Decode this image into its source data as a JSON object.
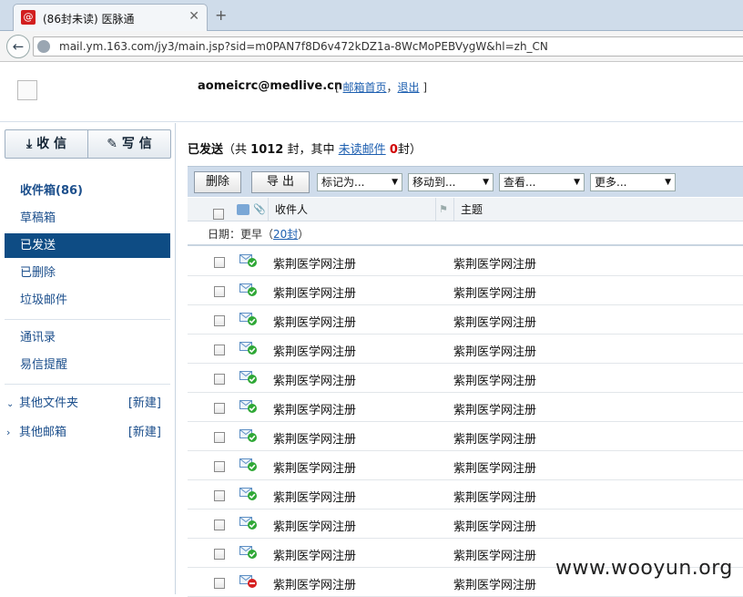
{
  "browser": {
    "tab_title": "(86封未读) 医脉通",
    "tab_favicon": "@",
    "tab_close": "✕",
    "new_tab": "+",
    "url": "mail.ym.163.com/jy3/main.jsp?sid=m0PAN7f8D6v472kDZ1a-8WcMoPEBVygW&hl=zh_CN"
  },
  "header": {
    "email": "aomeicrc@medlive.cn",
    "bracket_open": "[",
    "home_link": "邮箱首页",
    "comma": "，",
    "logout_link": "退出",
    "bracket_close": "]"
  },
  "sidebar": {
    "receive_label": "收 信",
    "compose_label": "写 信",
    "items": [
      {
        "label": "收件箱(86)"
      },
      {
        "label": "草稿箱"
      },
      {
        "label": "已发送"
      },
      {
        "label": "已删除"
      },
      {
        "label": "垃圾邮件"
      },
      {
        "label": "通讯录"
      },
      {
        "label": "易信提醒"
      }
    ],
    "other_folders": "其他文件夹",
    "other_mailboxes": "其他邮箱",
    "new_link": "[新建]"
  },
  "main": {
    "title": "已发送",
    "summary_pre": "（共",
    "total": "1012",
    "summary_mid": "封，其中",
    "unread_link": "未读邮件",
    "unread_count": "0",
    "summary_post": "封）",
    "toolbar": {
      "delete": "删除",
      "export": "导 出",
      "mark_as": "标记为...",
      "move_to": "移动到...",
      "view": "查看...",
      "more": "更多..."
    },
    "columns": {
      "recipient": "收件人",
      "subject": "主题"
    },
    "date_group": {
      "label": "日期：更早（",
      "count_link": "20封",
      "close": "）"
    },
    "rows": [
      {
        "recipient": "紫荆医学网注册",
        "subject": "紫荆医学网注册",
        "status": "ok"
      },
      {
        "recipient": "紫荆医学网注册",
        "subject": "紫荆医学网注册",
        "status": "ok"
      },
      {
        "recipient": "紫荆医学网注册",
        "subject": "紫荆医学网注册",
        "status": "ok"
      },
      {
        "recipient": "紫荆医学网注册",
        "subject": "紫荆医学网注册",
        "status": "ok"
      },
      {
        "recipient": "紫荆医学网注册",
        "subject": "紫荆医学网注册",
        "status": "ok"
      },
      {
        "recipient": "紫荆医学网注册",
        "subject": "紫荆医学网注册",
        "status": "ok"
      },
      {
        "recipient": "紫荆医学网注册",
        "subject": "紫荆医学网注册",
        "status": "ok"
      },
      {
        "recipient": "紫荆医学网注册",
        "subject": "紫荆医学网注册",
        "status": "ok"
      },
      {
        "recipient": "紫荆医学网注册",
        "subject": "紫荆医学网注册",
        "status": "ok"
      },
      {
        "recipient": "紫荆医学网注册",
        "subject": "紫荆医学网注册",
        "status": "ok"
      },
      {
        "recipient": "紫荆医学网注册",
        "subject": "紫荆医学网注册",
        "status": "ok"
      },
      {
        "recipient": "紫荆医学网注册",
        "subject": "紫荆医学网注册",
        "status": "failed"
      }
    ]
  },
  "watermark": "www.wooyun.org",
  "colors": {
    "accent": "#0e4c84",
    "link": "#1d5fb0",
    "unread_count": "#d00000",
    "sent_ok": "#2fa836",
    "sent_failed": "#d62020"
  }
}
